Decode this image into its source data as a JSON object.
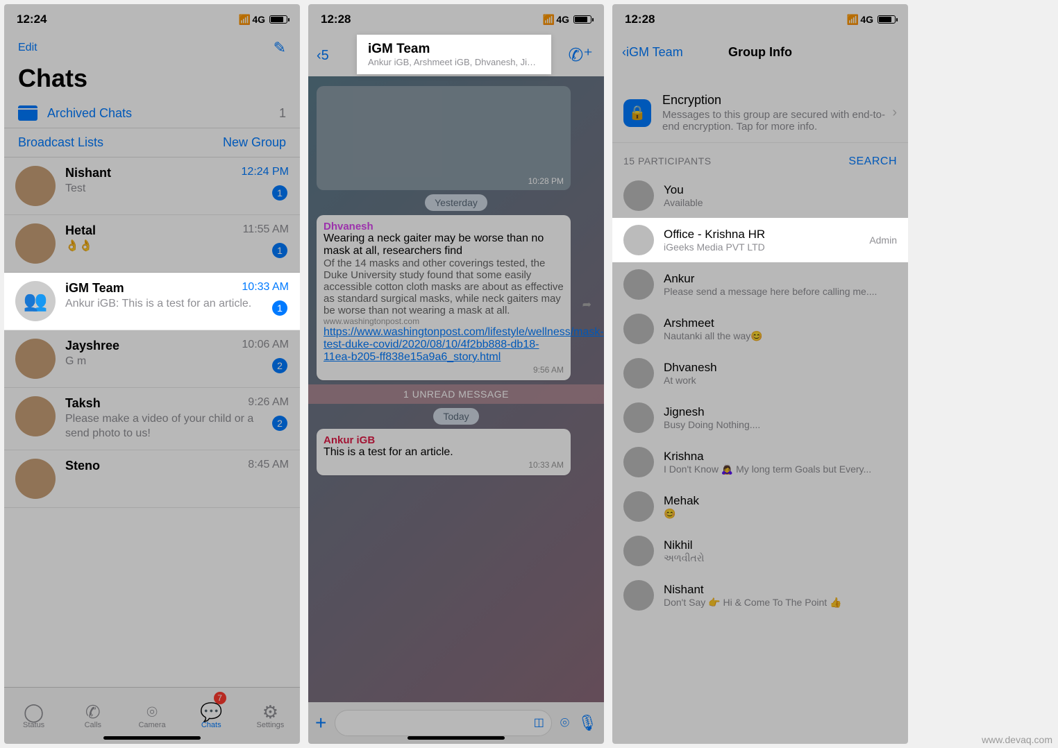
{
  "screen1": {
    "time": "12:24",
    "network": "4G",
    "edit": "Edit",
    "title": "Chats",
    "archived": "Archived Chats",
    "archived_count": "1",
    "broadcast": "Broadcast Lists",
    "newgroup": "New Group",
    "chats": [
      {
        "name": "Nishant",
        "msg": "Test",
        "time": "12:24 PM",
        "badge": "1",
        "time_blue": true
      },
      {
        "name": "Hetal",
        "msg": "👌👌",
        "time": "11:55 AM",
        "badge": "1"
      },
      {
        "name": "iGM Team",
        "msg": "Ankur iGB: This is a test for an article.",
        "time": "10:33 AM",
        "badge": "1",
        "time_blue": true,
        "hl": true,
        "group": true
      },
      {
        "name": "Jayshree",
        "msg": "G m",
        "time": "10:06 AM",
        "badge": "2"
      },
      {
        "name": "Taksh",
        "msg": "Please make a video of your child or a send photo to us!",
        "time": "9:26 AM",
        "badge": "2"
      },
      {
        "name": "Steno",
        "msg": "",
        "time": "8:45 AM"
      }
    ],
    "tabs": {
      "status": "Status",
      "calls": "Calls",
      "camera": "Camera",
      "chats": "Chats",
      "settings": "Settings",
      "chats_badge": "7"
    }
  },
  "screen2": {
    "time": "12:28",
    "network": "4G",
    "back_count": "5",
    "group_name": "iGM Team",
    "group_members": "Ankur iGB, Arshmeet iGB, Dhvanesh, Jignesh, Kris...",
    "img_time": "10:28 PM",
    "yesterday": "Yesterday",
    "msg1_sender": "Dhvanesh",
    "msg1_title": "Wearing a neck gaiter may be worse than no mask at all, researchers find",
    "msg1_body": "Of the 14 masks and other coverings tested, the Duke University study found that some easily accessible cotton cloth masks are about as effective as standard surgical masks, while neck gaiters may be worse than not wearing a mask at all.",
    "msg1_source": "www.washingtonpost.com",
    "msg1_link": "https://www.washingtonpost.com/lifestyle/wellness/mask-test-duke-covid/2020/08/10/4f2bb888-db18-11ea-b205-ff838e15a9a6_story.html",
    "msg1_time": "9:56 AM",
    "unread": "1 UNREAD MESSAGE",
    "today": "Today",
    "msg2_sender": "Ankur iGB",
    "msg2_body": "This is a test for an article.",
    "msg2_time": "10:33 AM"
  },
  "screen3": {
    "time": "12:28",
    "network": "4G",
    "back": "iGM Team",
    "title": "Group Info",
    "enc_title": "Encryption",
    "enc_body": "Messages to this group are secured with end-to-end encryption. Tap for more info.",
    "participants_hdr": "15 PARTICIPANTS",
    "search": "SEARCH",
    "participants": [
      {
        "name": "You",
        "sub": "Available"
      },
      {
        "name": "Office - Krishna HR",
        "sub": "iGeeks Media PVT LTD",
        "admin": "Admin",
        "hl": true
      },
      {
        "name": "Ankur",
        "sub": "Please send a message here before calling me...."
      },
      {
        "name": "Arshmeet",
        "sub": "Nautanki all the way😊"
      },
      {
        "name": "Dhvanesh",
        "sub": "At work"
      },
      {
        "name": "Jignesh",
        "sub": "Busy Doing Nothing...."
      },
      {
        "name": "Krishna",
        "sub": "I Don't Know 🙇‍♀️ My long term Goals but Every..."
      },
      {
        "name": "Mehak",
        "sub": "😊"
      },
      {
        "name": "Nikhil",
        "sub": "અળવીતરો"
      },
      {
        "name": "Nishant",
        "sub": "Don't Say 👉 Hi & Come To The Point 👍"
      }
    ]
  },
  "watermark": "www.devaq.com"
}
